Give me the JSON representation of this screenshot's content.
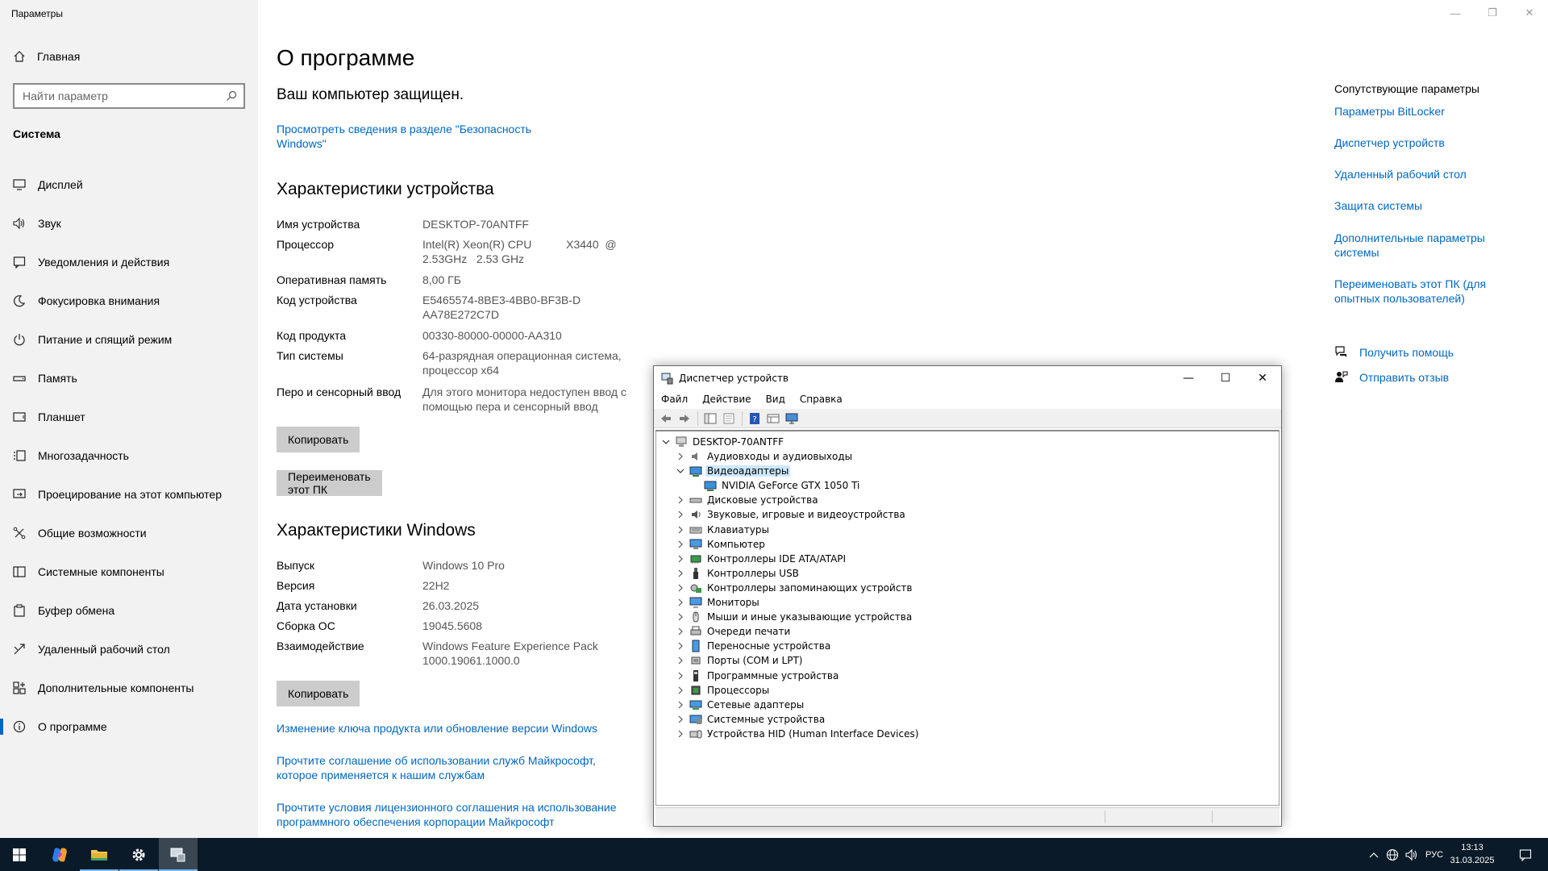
{
  "settings": {
    "app_title": "Параметры",
    "home_label": "Главная",
    "search_placeholder": "Найти параметр",
    "section": "Система",
    "nav": [
      {
        "label": "Дисплей",
        "icon": "display-icon"
      },
      {
        "label": "Звук",
        "icon": "sound-icon"
      },
      {
        "label": "Уведомления и действия",
        "icon": "notifications-icon"
      },
      {
        "label": "Фокусировка внимания",
        "icon": "focus-moon-icon"
      },
      {
        "label": "Питание и спящий режим",
        "icon": "power-icon"
      },
      {
        "label": "Память",
        "icon": "storage-icon"
      },
      {
        "label": "Планшет",
        "icon": "tablet-icon"
      },
      {
        "label": "Многозадачность",
        "icon": "multitasking-icon"
      },
      {
        "label": "Проецирование на этот компьютер",
        "icon": "project-icon"
      },
      {
        "label": "Общие возможности",
        "icon": "shared-experiences-icon"
      },
      {
        "label": "Системные компоненты",
        "icon": "system-components-icon"
      },
      {
        "label": "Буфер обмена",
        "icon": "clipboard-icon"
      },
      {
        "label": "Удаленный рабочий стол",
        "icon": "remote-desktop-icon"
      },
      {
        "label": "Дополнительные компоненты",
        "icon": "optional-features-icon"
      },
      {
        "label": "О программе",
        "icon": "info-icon",
        "active": true
      }
    ],
    "main": {
      "title": "О программе",
      "protected": "Ваш компьютер защищен.",
      "security_link": "Просмотреть сведения в разделе \"Безопасность Windows\"",
      "device_header": "Характеристики устройства",
      "device_specs": [
        {
          "key": "Имя устройства",
          "value": "DESKTOP-70ANTFF"
        },
        {
          "key": "Процессор",
          "value": "Intel(R) Xeon(R) CPU           X3440  @ 2.53GHz   2.53 GHz"
        },
        {
          "key": "Оперативная память",
          "value": "8,00 ГБ"
        },
        {
          "key": "Код устройства",
          "value": "E5465574-8BE3-4BB0-BF3B-DAA78E272C7D"
        },
        {
          "key": "Код продукта",
          "value": "00330-80000-00000-AA310"
        },
        {
          "key": "Тип системы",
          "value": "64-разрядная операционная система, процессор x64"
        },
        {
          "key": "Перо и сенсорный ввод",
          "value": "Для этого монитора недоступен ввод с помощью пера и сенсорный ввод"
        }
      ],
      "copy_label": "Копировать",
      "rename_label": "Переименовать этот ПК",
      "windows_header": "Характеристики Windows",
      "windows_specs": [
        {
          "key": "Выпуск",
          "value": "Windows 10 Pro"
        },
        {
          "key": "Версия",
          "value": "22H2"
        },
        {
          "key": "Дата установки",
          "value": "26.03.2025"
        },
        {
          "key": "Сборка ОС",
          "value": "19045.5608"
        },
        {
          "key": "Взаимодействие",
          "value": "Windows Feature Experience Pack 1000.19061.1000.0"
        }
      ],
      "copy2_label": "Копировать",
      "links": [
        "Изменение ключа продукта или обновление версии Windows",
        "Прочтите соглашение об использовании служб Майкрософт, которое применяется к нашим службам",
        "Прочтите условия лицензионного соглашения на использование программного обеспечения корпорации Майкрософт"
      ]
    },
    "related": {
      "header": "Сопутствующие параметры",
      "links": [
        "Параметры BitLocker",
        "Диспетчер устройств",
        "Удаленный рабочий стол",
        "Защита системы",
        "Дополнительные параметры системы",
        "Переименовать этот ПК (для опытных пользователей)"
      ],
      "help": "Получить помощь",
      "feedback": "Отправить отзыв"
    }
  },
  "devmgr": {
    "title": "Диспетчер устройств",
    "menu": [
      "Файл",
      "Действие",
      "Вид",
      "Справка"
    ],
    "root": "DESKTOP-70ANTFF",
    "tree": [
      {
        "label": "Аудиовходы и аудиовыходы",
        "icon": "audio-icon",
        "expanded": false
      },
      {
        "label": "Видеоадаптеры",
        "icon": "display-adapter-icon",
        "expanded": true,
        "selected": true
      },
      {
        "label": "NVIDIA GeForce GTX 1050 Ti",
        "icon": "display-adapter-icon",
        "child": true
      },
      {
        "label": "Дисковые устройства",
        "icon": "disk-icon",
        "expanded": false
      },
      {
        "label": "Звуковые, игровые и видеоустройства",
        "icon": "sound-device-icon",
        "expanded": false
      },
      {
        "label": "Клавиатуры",
        "icon": "keyboard-icon",
        "expanded": false
      },
      {
        "label": "Компьютер",
        "icon": "computer-icon",
        "expanded": false
      },
      {
        "label": "Контроллеры IDE ATA/ATAPI",
        "icon": "ide-controller-icon",
        "expanded": false
      },
      {
        "label": "Контроллеры USB",
        "icon": "usb-icon",
        "expanded": false
      },
      {
        "label": "Контроллеры запоминающих устройств",
        "icon": "storage-controller-icon",
        "expanded": false
      },
      {
        "label": "Мониторы",
        "icon": "monitor-icon",
        "expanded": false
      },
      {
        "label": "Мыши и иные указывающие устройства",
        "icon": "mouse-icon",
        "expanded": false
      },
      {
        "label": "Очереди печати",
        "icon": "printer-icon",
        "expanded": false
      },
      {
        "label": "Переносные устройства",
        "icon": "portable-device-icon",
        "expanded": false
      },
      {
        "label": "Порты (COM и LPT)",
        "icon": "port-icon",
        "expanded": false
      },
      {
        "label": "Программные устройства",
        "icon": "software-device-icon",
        "expanded": false
      },
      {
        "label": "Процессоры",
        "icon": "processor-icon",
        "expanded": false
      },
      {
        "label": "Сетевые адаптеры",
        "icon": "network-adapter-icon",
        "expanded": false
      },
      {
        "label": "Системные устройства",
        "icon": "system-device-icon",
        "expanded": false
      },
      {
        "label": "Устройства HID (Human Interface Devices)",
        "icon": "hid-icon",
        "expanded": false
      }
    ]
  },
  "taskbar": {
    "lang": "РУС",
    "time": "13:13",
    "date": "31.03.2025"
  },
  "colors": {
    "accent": "#0067c0",
    "sidebar": "#f2f2f2",
    "taskbar": "#0b1a28",
    "selection": "#cce8ff"
  }
}
